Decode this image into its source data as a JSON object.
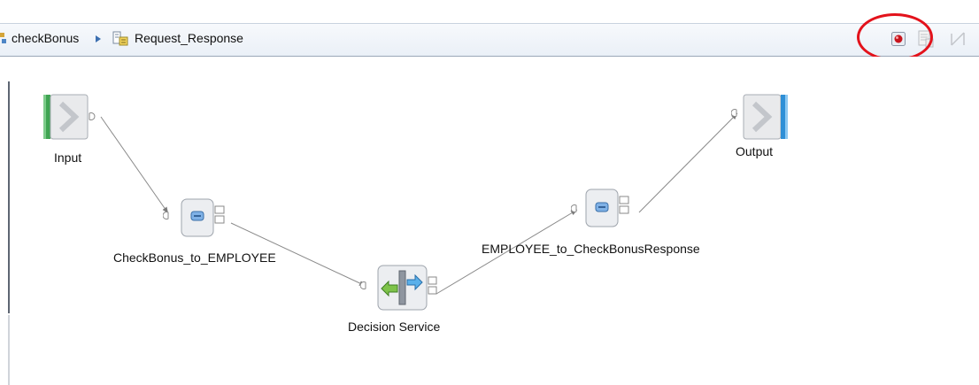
{
  "breadcrumb": {
    "flow": "checkBonus",
    "operation": "Request_Response"
  },
  "nodes": {
    "input": "Input",
    "map1": "CheckBonus_to_EMPLOYEE",
    "decision": "Decision Service",
    "map2": "EMPLOYEE_to_CheckBonusResponse",
    "output": "Output"
  },
  "toolbar": {
    "icons": [
      "breakpoint-icon",
      "properties-icon",
      "connect-icon"
    ]
  },
  "colors": {
    "highlight": "#e3121b",
    "input_bar": "#3fa452",
    "output_bar": "#2e8fd6"
  }
}
